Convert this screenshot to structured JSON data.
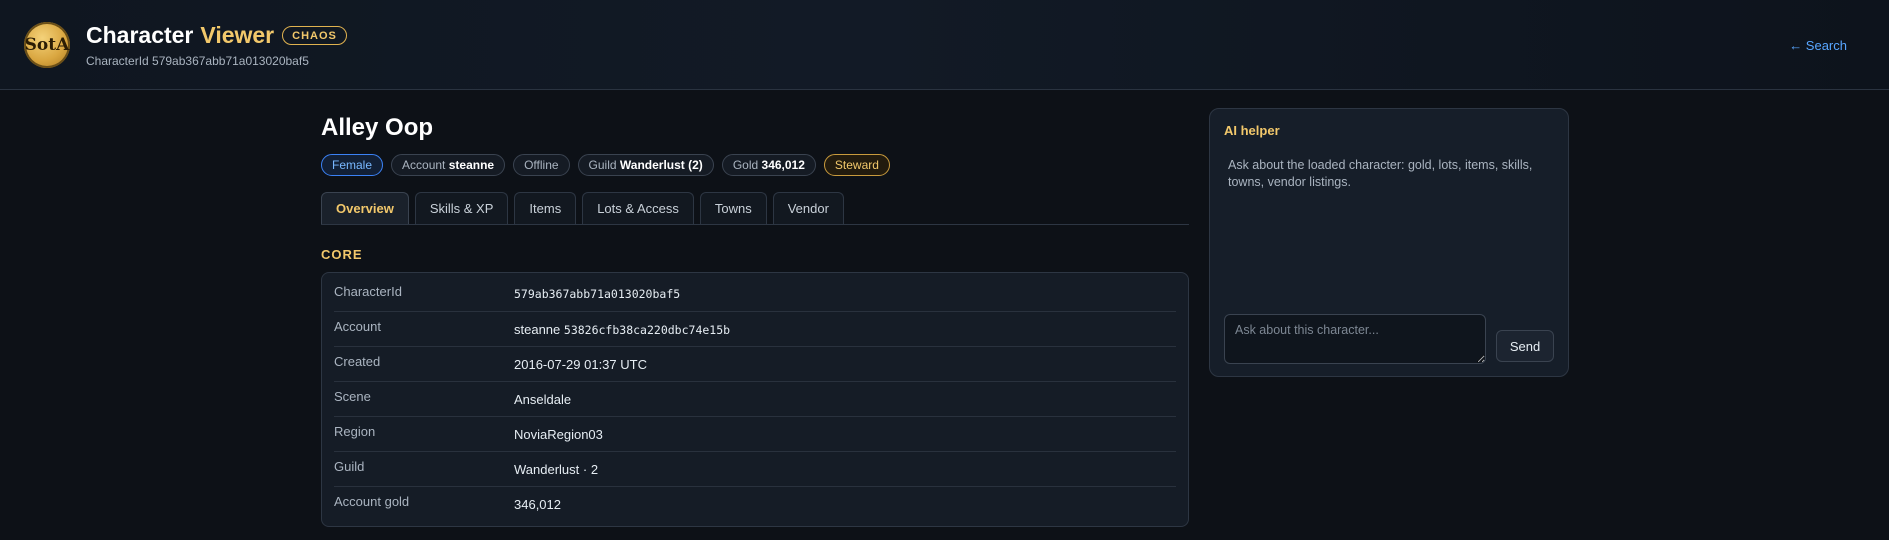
{
  "header": {
    "logo_text": "SotA",
    "title_main": "Character",
    "title_accent": "Viewer",
    "mode_badge": "CHAOS",
    "character_id_line": "CharacterId 579ab367abb71a013020baf5",
    "search_link": "← Search"
  },
  "character": {
    "name": "Alley Oop",
    "pills": {
      "gender": "Female",
      "account_label": "Account",
      "account_value": "steanne",
      "status": "Offline",
      "guild_label": "Guild",
      "guild_value": "Wanderlust (2)",
      "gold_label": "Gold",
      "gold_value": "346,012",
      "role": "Steward"
    }
  },
  "tabs": [
    {
      "label": "Overview",
      "active": true
    },
    {
      "label": "Skills & XP",
      "active": false
    },
    {
      "label": "Items",
      "active": false
    },
    {
      "label": "Lots & Access",
      "active": false
    },
    {
      "label": "Towns",
      "active": false
    },
    {
      "label": "Vendor",
      "active": false
    }
  ],
  "core": {
    "section_title": "CORE",
    "rows": [
      {
        "label": "CharacterId",
        "value": "579ab367abb71a013020baf5"
      },
      {
        "label": "Account",
        "value_name": "steanne",
        "value_id": "53826cfb38ca220dbc74e15b"
      },
      {
        "label": "Created",
        "value": "2016-07-29 01:37 UTC"
      },
      {
        "label": "Scene",
        "value": "Anseldale"
      },
      {
        "label": "Region",
        "value": "NoviaRegion03"
      },
      {
        "label": "Guild",
        "value": "Wanderlust · 2"
      },
      {
        "label": "Account gold",
        "value": "346,012"
      }
    ]
  },
  "ai_helper": {
    "title": "AI helper",
    "description": "Ask about the loaded character: gold, lots, items, skills, towns, vendor listings.",
    "input_placeholder": "Ask about this character...",
    "send_label": "Send"
  },
  "colors": {
    "background": "#0d1117",
    "accent_gold": "#f2c86b",
    "link_blue": "#58a6ff"
  }
}
